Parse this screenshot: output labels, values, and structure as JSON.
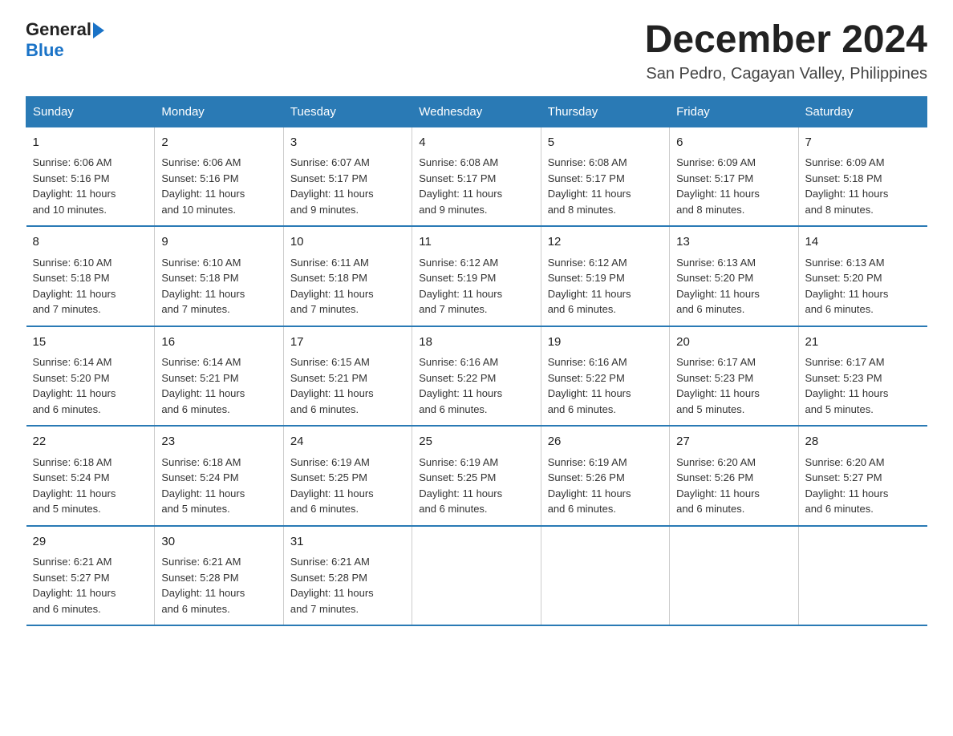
{
  "logo": {
    "general": "General",
    "blue": "Blue"
  },
  "header": {
    "month": "December 2024",
    "location": "San Pedro, Cagayan Valley, Philippines"
  },
  "days_of_week": [
    "Sunday",
    "Monday",
    "Tuesday",
    "Wednesday",
    "Thursday",
    "Friday",
    "Saturday"
  ],
  "weeks": [
    [
      {
        "day": "1",
        "sunrise": "6:06 AM",
        "sunset": "5:16 PM",
        "daylight": "11 hours and 10 minutes."
      },
      {
        "day": "2",
        "sunrise": "6:06 AM",
        "sunset": "5:16 PM",
        "daylight": "11 hours and 10 minutes."
      },
      {
        "day": "3",
        "sunrise": "6:07 AM",
        "sunset": "5:17 PM",
        "daylight": "11 hours and 9 minutes."
      },
      {
        "day": "4",
        "sunrise": "6:08 AM",
        "sunset": "5:17 PM",
        "daylight": "11 hours and 9 minutes."
      },
      {
        "day": "5",
        "sunrise": "6:08 AM",
        "sunset": "5:17 PM",
        "daylight": "11 hours and 8 minutes."
      },
      {
        "day": "6",
        "sunrise": "6:09 AM",
        "sunset": "5:17 PM",
        "daylight": "11 hours and 8 minutes."
      },
      {
        "day": "7",
        "sunrise": "6:09 AM",
        "sunset": "5:18 PM",
        "daylight": "11 hours and 8 minutes."
      }
    ],
    [
      {
        "day": "8",
        "sunrise": "6:10 AM",
        "sunset": "5:18 PM",
        "daylight": "11 hours and 7 minutes."
      },
      {
        "day": "9",
        "sunrise": "6:10 AM",
        "sunset": "5:18 PM",
        "daylight": "11 hours and 7 minutes."
      },
      {
        "day": "10",
        "sunrise": "6:11 AM",
        "sunset": "5:18 PM",
        "daylight": "11 hours and 7 minutes."
      },
      {
        "day": "11",
        "sunrise": "6:12 AM",
        "sunset": "5:19 PM",
        "daylight": "11 hours and 7 minutes."
      },
      {
        "day": "12",
        "sunrise": "6:12 AM",
        "sunset": "5:19 PM",
        "daylight": "11 hours and 6 minutes."
      },
      {
        "day": "13",
        "sunrise": "6:13 AM",
        "sunset": "5:20 PM",
        "daylight": "11 hours and 6 minutes."
      },
      {
        "day": "14",
        "sunrise": "6:13 AM",
        "sunset": "5:20 PM",
        "daylight": "11 hours and 6 minutes."
      }
    ],
    [
      {
        "day": "15",
        "sunrise": "6:14 AM",
        "sunset": "5:20 PM",
        "daylight": "11 hours and 6 minutes."
      },
      {
        "day": "16",
        "sunrise": "6:14 AM",
        "sunset": "5:21 PM",
        "daylight": "11 hours and 6 minutes."
      },
      {
        "day": "17",
        "sunrise": "6:15 AM",
        "sunset": "5:21 PM",
        "daylight": "11 hours and 6 minutes."
      },
      {
        "day": "18",
        "sunrise": "6:16 AM",
        "sunset": "5:22 PM",
        "daylight": "11 hours and 6 minutes."
      },
      {
        "day": "19",
        "sunrise": "6:16 AM",
        "sunset": "5:22 PM",
        "daylight": "11 hours and 6 minutes."
      },
      {
        "day": "20",
        "sunrise": "6:17 AM",
        "sunset": "5:23 PM",
        "daylight": "11 hours and 5 minutes."
      },
      {
        "day": "21",
        "sunrise": "6:17 AM",
        "sunset": "5:23 PM",
        "daylight": "11 hours and 5 minutes."
      }
    ],
    [
      {
        "day": "22",
        "sunrise": "6:18 AM",
        "sunset": "5:24 PM",
        "daylight": "11 hours and 5 minutes."
      },
      {
        "day": "23",
        "sunrise": "6:18 AM",
        "sunset": "5:24 PM",
        "daylight": "11 hours and 5 minutes."
      },
      {
        "day": "24",
        "sunrise": "6:19 AM",
        "sunset": "5:25 PM",
        "daylight": "11 hours and 6 minutes."
      },
      {
        "day": "25",
        "sunrise": "6:19 AM",
        "sunset": "5:25 PM",
        "daylight": "11 hours and 6 minutes."
      },
      {
        "day": "26",
        "sunrise": "6:19 AM",
        "sunset": "5:26 PM",
        "daylight": "11 hours and 6 minutes."
      },
      {
        "day": "27",
        "sunrise": "6:20 AM",
        "sunset": "5:26 PM",
        "daylight": "11 hours and 6 minutes."
      },
      {
        "day": "28",
        "sunrise": "6:20 AM",
        "sunset": "5:27 PM",
        "daylight": "11 hours and 6 minutes."
      }
    ],
    [
      {
        "day": "29",
        "sunrise": "6:21 AM",
        "sunset": "5:27 PM",
        "daylight": "11 hours and 6 minutes."
      },
      {
        "day": "30",
        "sunrise": "6:21 AM",
        "sunset": "5:28 PM",
        "daylight": "11 hours and 6 minutes."
      },
      {
        "day": "31",
        "sunrise": "6:21 AM",
        "sunset": "5:28 PM",
        "daylight": "11 hours and 7 minutes."
      },
      null,
      null,
      null,
      null
    ]
  ],
  "labels": {
    "sunrise": "Sunrise:",
    "sunset": "Sunset:",
    "daylight": "Daylight:"
  }
}
